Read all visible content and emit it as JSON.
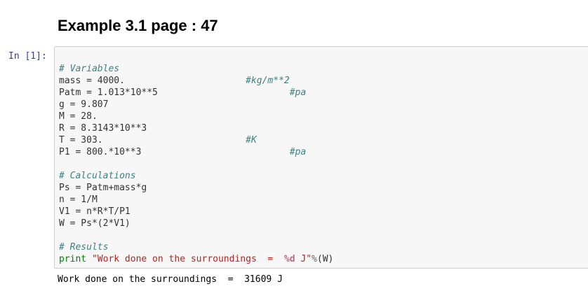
{
  "heading": "Example 3.1 page : 47",
  "prompt": "In [1]:",
  "code": {
    "comment_variables": "# Variables",
    "line_mass": "mass = 4000.",
    "comment_mass": "#kg/m**2",
    "line_patm": "Patm = 1.013*10**5",
    "comment_patm": "#pa",
    "line_g": "g = 9.807",
    "line_M": "M = 28.",
    "line_R": "R = 8.3143*10**3",
    "line_T": "T = 303.",
    "comment_T": "#K",
    "line_P1": "P1 = 800.*10**3",
    "comment_P1": "#pa",
    "comment_calculations": "# Calculations",
    "line_Ps": "Ps = Patm+mass*g",
    "line_n": "n = 1/M",
    "line_V1": "V1 = n*R*T/P1",
    "line_W": "W = Ps*(2*V1)",
    "comment_results": "# Results",
    "print_keyword": "print",
    "print_string_start": "\"Work done on the surroundings  =  ",
    "print_format": "%d",
    "print_string_end": " J\"",
    "print_operator": "%",
    "print_args": "(W)"
  },
  "output": "Work done on the surroundings  =  31609 J"
}
